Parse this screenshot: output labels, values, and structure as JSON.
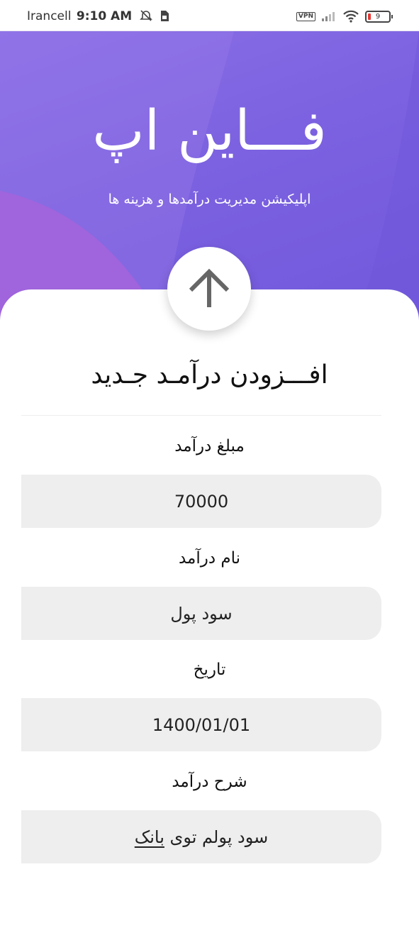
{
  "status_bar": {
    "carrier": "Irancell",
    "time": "9:10 AM",
    "vpn_label": "VPN",
    "battery_level": "9",
    "icons": [
      "alarm-off-icon",
      "sim-icon",
      "vpn-icon",
      "signal-icon",
      "wifi-icon",
      "battery-icon"
    ]
  },
  "header": {
    "app_title": "فـــاین اپ",
    "subtitle": "اپلیکیشن مدیریت درآمدها و هزینه ها",
    "colors": {
      "gradient_start": "#8a6fe6",
      "gradient_end": "#7158dc",
      "wave_accent": "#a064dc"
    }
  },
  "form": {
    "arrow_icon": "arrow-up-icon",
    "title": "افـــزودن درآمـد جـدید",
    "fields": [
      {
        "label": "مبلغ درآمد",
        "value": "70000"
      },
      {
        "label": "نام درآمد",
        "value": "سود پول"
      },
      {
        "label": "تاریخ",
        "value": "1400/01/01"
      },
      {
        "label": "شرح درآمد",
        "value_prefix": "سود پولم توی ",
        "value_underlined": "بانک"
      }
    ]
  }
}
